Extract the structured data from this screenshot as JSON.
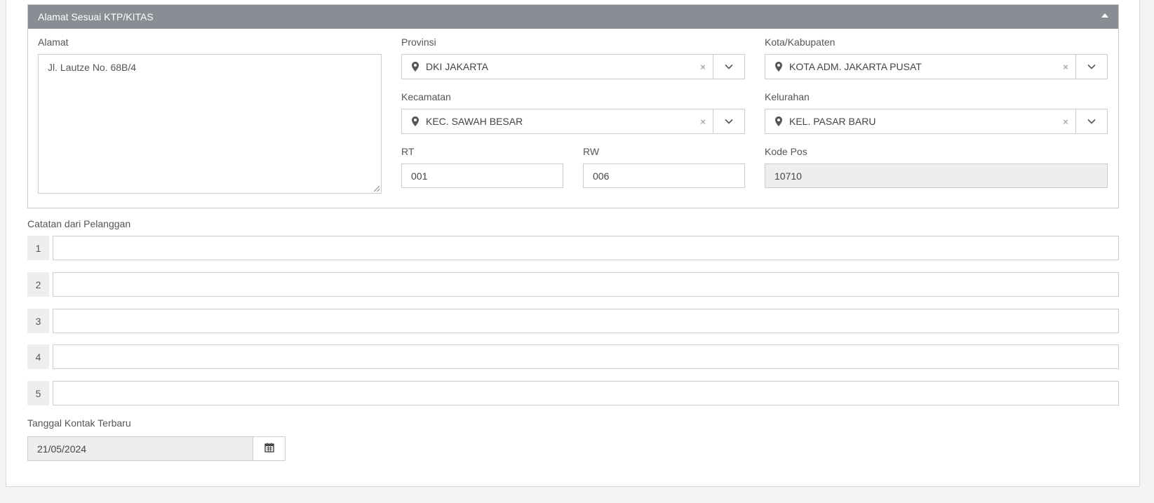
{
  "panel": {
    "title": "Alamat Sesuai KTP/KITAS",
    "toggle_icon": "caret-up-icon"
  },
  "address": {
    "label": "Alamat",
    "value": "Jl. Lautze No. 68B/4"
  },
  "provinsi": {
    "label": "Provinsi",
    "value": "DKI JAKARTA",
    "clear_glyph": "×",
    "icon": "map-marker-icon"
  },
  "kota": {
    "label": "Kota/Kabupaten",
    "value": "KOTA ADM. JAKARTA PUSAT",
    "clear_glyph": "×",
    "icon": "map-marker-icon"
  },
  "kecamatan": {
    "label": "Kecamatan",
    "value": "KEC. SAWAH BESAR",
    "clear_glyph": "×",
    "icon": "map-marker-icon"
  },
  "kelurahan": {
    "label": "Kelurahan",
    "value": "KEL. PASAR BARU",
    "clear_glyph": "×",
    "icon": "map-marker-icon"
  },
  "rt": {
    "label": "RT",
    "value": "001"
  },
  "rw": {
    "label": "RW",
    "value": "006"
  },
  "kodepos": {
    "label": "Kode Pos",
    "value": "10710"
  },
  "notes": {
    "label": "Catatan dari Pelanggan",
    "items": [
      {
        "num": "1",
        "value": ""
      },
      {
        "num": "2",
        "value": ""
      },
      {
        "num": "3",
        "value": ""
      },
      {
        "num": "4",
        "value": ""
      },
      {
        "num": "5",
        "value": ""
      }
    ]
  },
  "last_contact": {
    "label": "Tanggal Kontak Terbaru",
    "value": "21/05/2024",
    "icon": "calendar-icon"
  },
  "colors": {
    "panel_header_bg": "#8a8d93",
    "border": "#cccccc",
    "readonly_bg": "#eeeeee",
    "page_bg": "#f3f4f6"
  }
}
